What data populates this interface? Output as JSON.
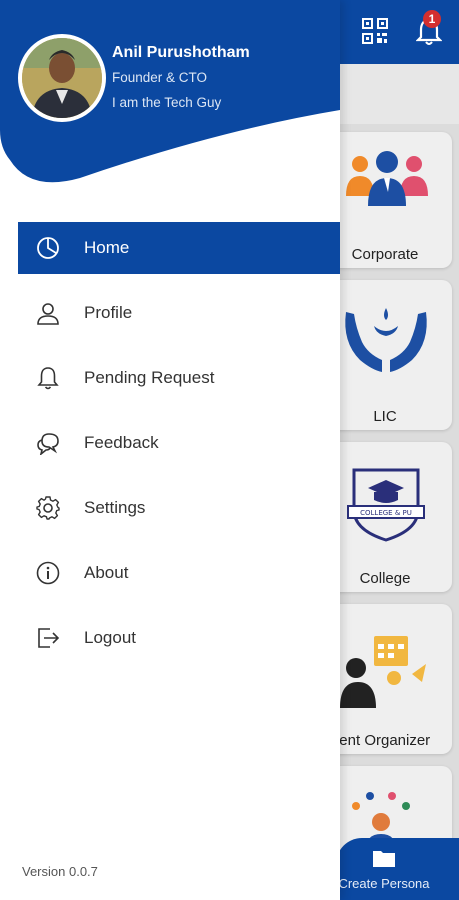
{
  "user": {
    "name": "Anil Purushotham",
    "role": "Founder & CTO",
    "tagline": "I am the Tech Guy"
  },
  "menu": {
    "items": [
      {
        "label": "Home",
        "icon": "pie-chart-icon",
        "active": true
      },
      {
        "label": "Profile",
        "icon": "person-icon",
        "active": false
      },
      {
        "label": "Pending Request",
        "icon": "bell-icon",
        "active": false
      },
      {
        "label": "Feedback",
        "icon": "chat-bubbles-icon",
        "active": false
      },
      {
        "label": "Settings",
        "icon": "gear-icon",
        "active": false
      },
      {
        "label": "About",
        "icon": "info-icon",
        "active": false
      },
      {
        "label": "Logout",
        "icon": "logout-icon",
        "active": false
      }
    ]
  },
  "footer": {
    "version": "Version 0.0.7"
  },
  "background": {
    "notification_count": "1",
    "categories": [
      "Corporate",
      "LIC",
      "College",
      "vent Organizer"
    ],
    "create_label": "Create Persona",
    "college_badge_text": "COLLEGE & PU"
  },
  "colors": {
    "brand": "#0b48a1",
    "badge": "#d32f2f"
  }
}
